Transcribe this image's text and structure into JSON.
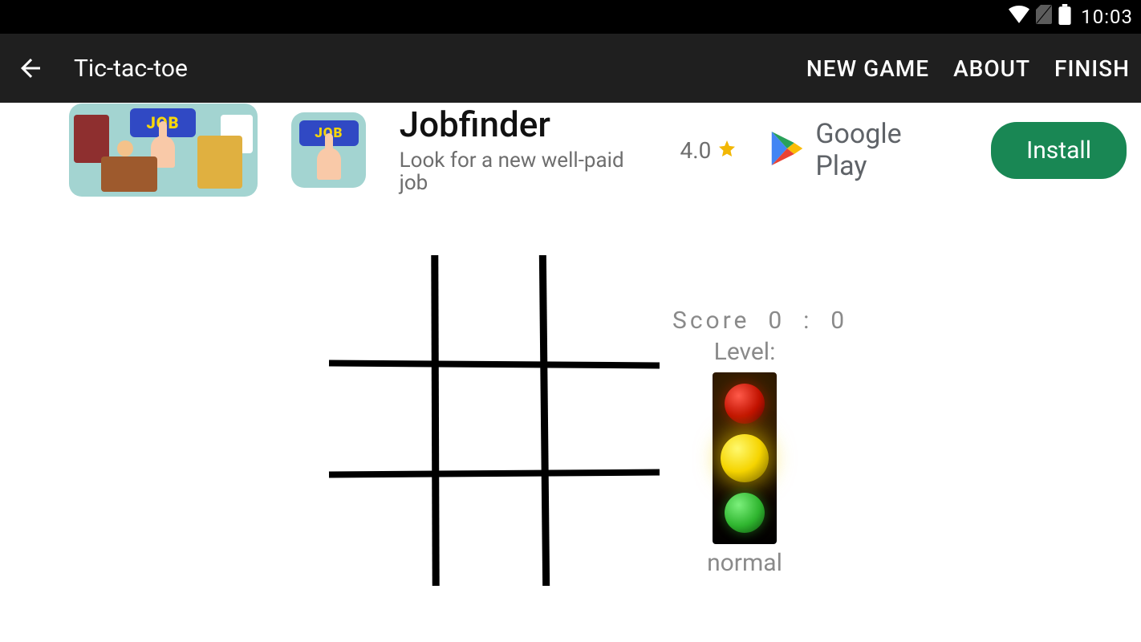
{
  "status_bar": {
    "clock": "10:03",
    "icons": [
      "wifi-icon",
      "no-sim-icon",
      "battery-icon"
    ]
  },
  "app_bar": {
    "title": "Tic-tac-toe",
    "actions": {
      "new_game": "NEW GAME",
      "about": "ABOUT",
      "finish": "FINISH"
    }
  },
  "ad": {
    "title": "Jobfinder",
    "subtitle": "Look for a new well-paid job",
    "rating": "4.0",
    "store": "Google Play",
    "install": "Install",
    "icon_badge": "JOB"
  },
  "game": {
    "score_label": "Score",
    "score_player": "0",
    "score_separator": ":",
    "score_cpu": "0",
    "level_label": "Level:",
    "level_name": "normal"
  }
}
